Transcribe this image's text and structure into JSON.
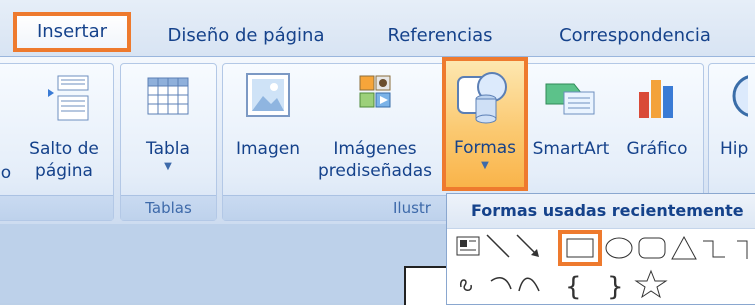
{
  "tabs": [
    {
      "label": "Insertar"
    },
    {
      "label": "Diseño de página"
    },
    {
      "label": "Referencias"
    },
    {
      "label": "Correspondencia"
    }
  ],
  "ribbon": {
    "salto": {
      "line1": "Salto de",
      "line2": "página",
      "left_clip": "o"
    },
    "tabla": {
      "label": "Tabla"
    },
    "tablas_group": "Tablas",
    "imagen": {
      "label": "Imagen"
    },
    "imagenes_pred": {
      "line1": "Imágenes",
      "line2": "prediseñadas"
    },
    "formas": {
      "label": "Formas"
    },
    "smartart": {
      "label": "SmartArt"
    },
    "grafico": {
      "label": "Gráfico"
    },
    "hipervinculo": {
      "label": "Hip"
    },
    "ilustraciones_group": "Ilustr"
  },
  "shapes_panel": {
    "title": "Formas usadas recientemente"
  },
  "colors": {
    "highlight_border": "#ee7a2e",
    "text_blue": "#15428b"
  }
}
